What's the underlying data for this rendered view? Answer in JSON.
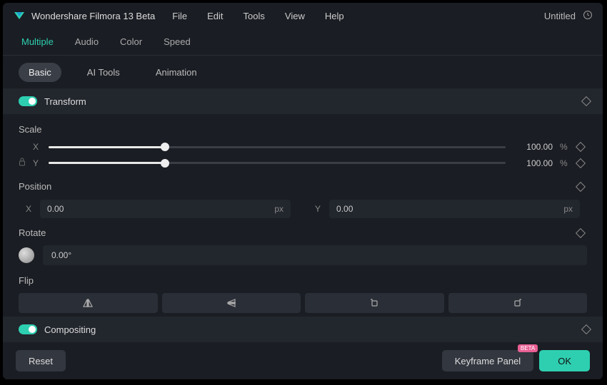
{
  "titlebar": {
    "app_name": "Wondershare Filmora 13 Beta",
    "menu": {
      "file": "File",
      "edit": "Edit",
      "tools": "Tools",
      "view": "View",
      "help": "Help"
    },
    "project_name": "Untitled"
  },
  "tabs_primary": {
    "multiple": "Multiple",
    "audio": "Audio",
    "color": "Color",
    "speed": "Speed"
  },
  "tabs_secondary": {
    "basic": "Basic",
    "ai_tools": "AI Tools",
    "animation": "Animation"
  },
  "sections": {
    "transform": {
      "label": "Transform",
      "scale": {
        "label": "Scale",
        "x_axis": "X",
        "y_axis": "Y",
        "x_value": "100.00",
        "y_value": "100.00",
        "unit": "%"
      },
      "position": {
        "label": "Position",
        "x_axis": "X",
        "y_axis": "Y",
        "x_value": "0.00",
        "y_value": "0.00",
        "unit": "px"
      },
      "rotate": {
        "label": "Rotate",
        "value": "0.00°"
      },
      "flip": {
        "label": "Flip"
      }
    },
    "compositing": {
      "label": "Compositing"
    }
  },
  "footer": {
    "reset": "Reset",
    "keyframe_panel": "Keyframe Panel",
    "badge": "BETA",
    "ok": "OK"
  }
}
